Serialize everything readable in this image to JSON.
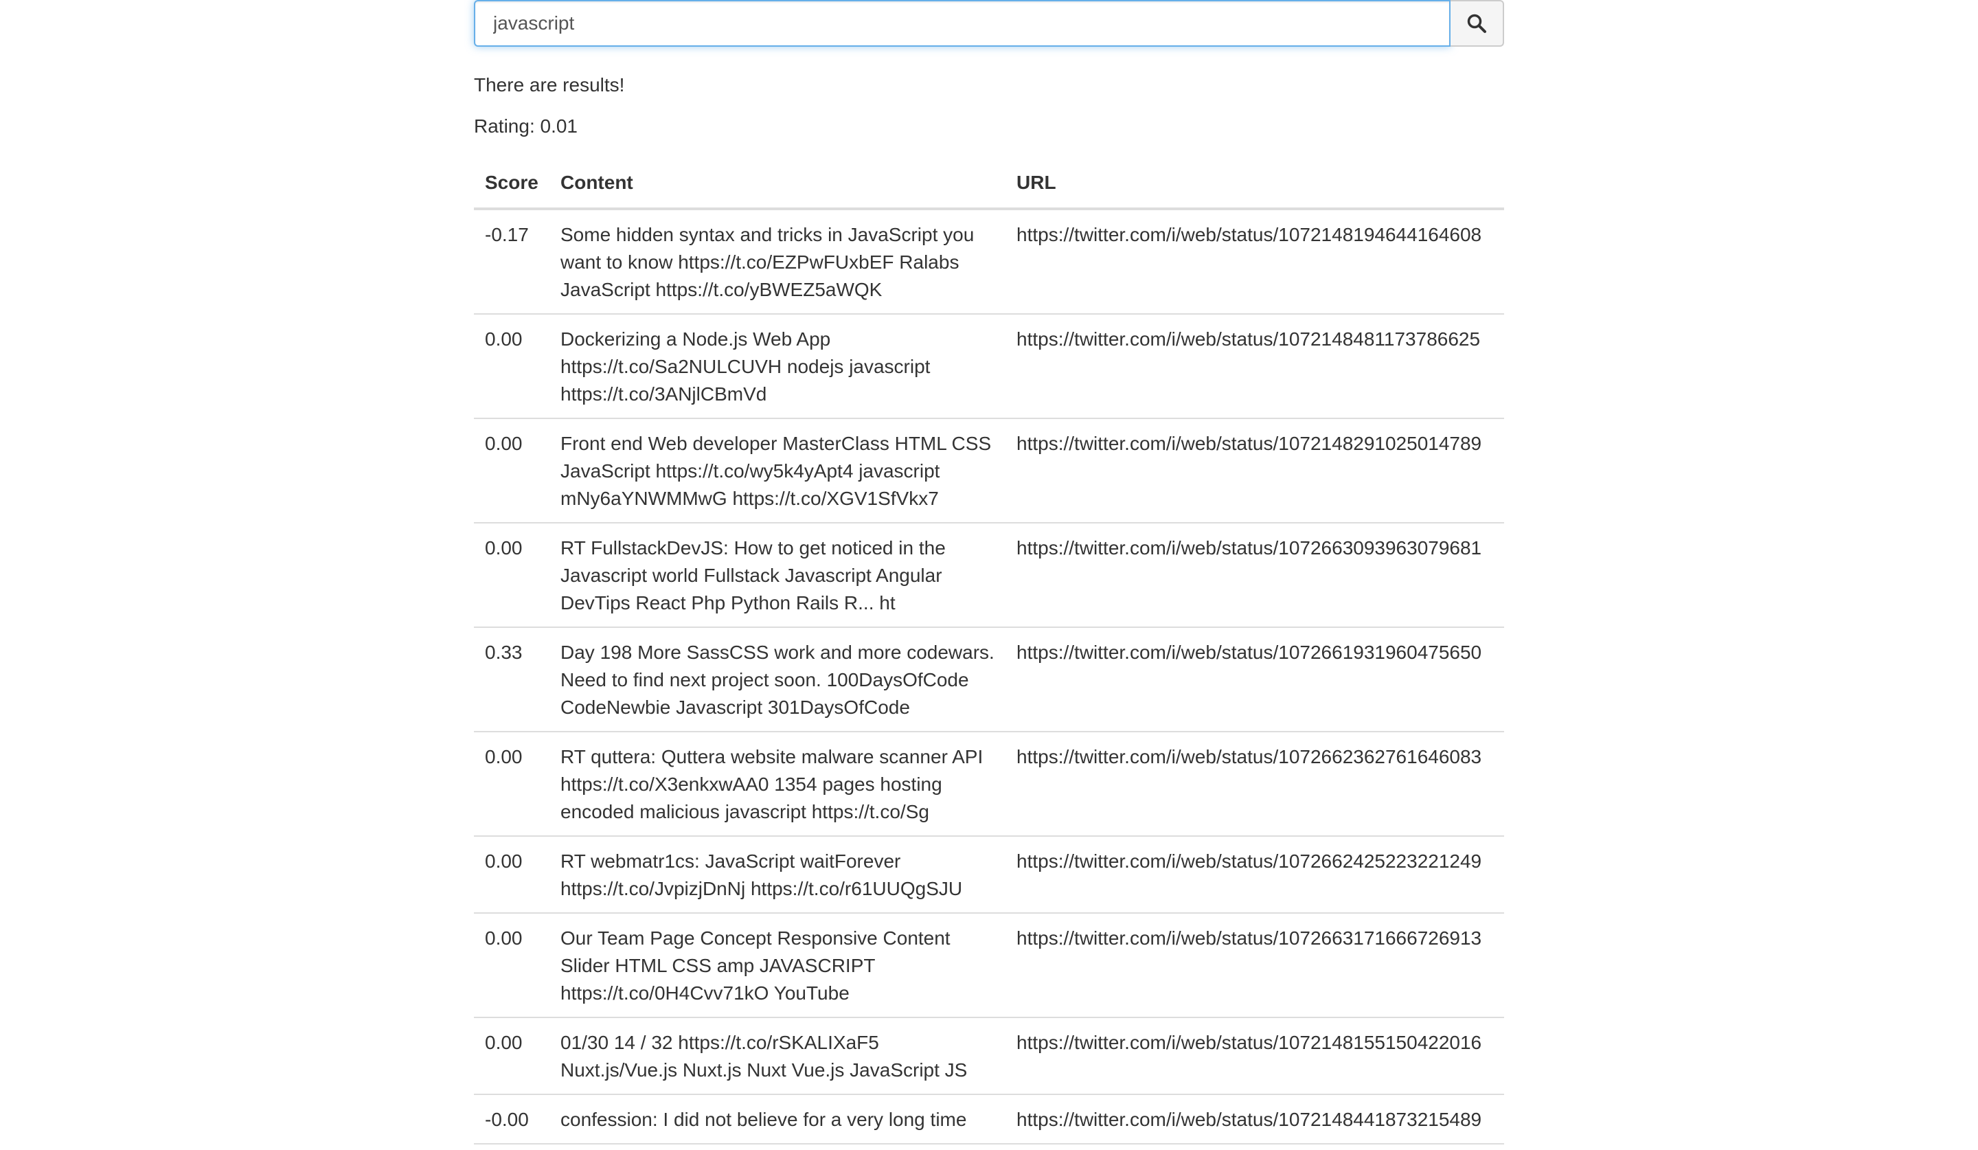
{
  "search": {
    "value": "javascript",
    "button_icon": "search-icon"
  },
  "status": "There are results!",
  "rating": "Rating: 0.01",
  "table": {
    "headers": [
      "Score",
      "Content",
      "URL"
    ],
    "rows": [
      {
        "score": "-0.17",
        "content": "Some hidden syntax and tricks in JavaScript you want to know https://t.co/EZPwFUxbEF Ralabs JavaScript https://t.co/yBWEZ5aWQK",
        "url": "https://twitter.com/i/web/status/1072148194644164608"
      },
      {
        "score": "0.00",
        "content": "Dockerizing a Node.js Web App https://t.co/Sa2NULCUVH nodejs javascript https://t.co/3ANjlCBmVd",
        "url": "https://twitter.com/i/web/status/1072148481173786625"
      },
      {
        "score": "0.00",
        "content": "Front end Web developer MasterClass HTML CSS JavaScript https://t.co/wy5k4yApt4 javascript mNy6aYNWMMwG https://t.co/XGV1SfVkx7",
        "url": "https://twitter.com/i/web/status/1072148291025014789"
      },
      {
        "score": "0.00",
        "content": "RT FullstackDevJS: How to get noticed in the Javascript world Fullstack Javascript Angular DevTips React Php Python Rails R... ht",
        "url": "https://twitter.com/i/web/status/1072663093963079681"
      },
      {
        "score": "0.33",
        "content": "Day 198 More SassCSS work and more codewars. Need to find next project soon. 100DaysOfCode CodeNewbie Javascript 301DaysOfCode",
        "url": "https://twitter.com/i/web/status/1072661931960475650"
      },
      {
        "score": "0.00",
        "content": "RT quttera: Quttera website malware scanner API https://t.co/X3enkxwAA0 1354 pages hosting encoded malicious javascript https://t.co/Sg",
        "url": "https://twitter.com/i/web/status/1072662362761646083"
      },
      {
        "score": "0.00",
        "content": "RT webmatr1cs: JavaScript waitForever https://t.co/JvpizjDnNj https://t.co/r61UUQgSJU",
        "url": "https://twitter.com/i/web/status/1072662425223221249"
      },
      {
        "score": "0.00",
        "content": "Our Team Page Concept Responsive Content Slider HTML CSS amp JAVASCRIPT https://t.co/0H4Cvv71kO YouTube",
        "url": "https://twitter.com/i/web/status/1072663171666726913"
      },
      {
        "score": "0.00",
        "content": "01/30 14 / 32 https://t.co/rSKALIXaF5 Nuxt.js/Vue.js Nuxt.js Nuxt Vue.js JavaScript JS",
        "url": "https://twitter.com/i/web/status/1072148155150422016"
      },
      {
        "score": "-0.00",
        "content": "confession: I did not believe for a very long time",
        "url": "https://twitter.com/i/web/status/1072148441873215489"
      }
    ]
  }
}
